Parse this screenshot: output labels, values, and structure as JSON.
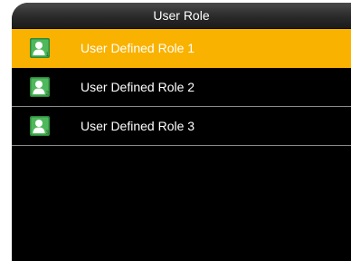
{
  "header": {
    "title": "User Role"
  },
  "roles": [
    {
      "label": "User Defined Role 1",
      "icon": "user-role-1-icon",
      "selected": true
    },
    {
      "label": "User Defined Role 2",
      "icon": "user-role-2-icon",
      "selected": false
    },
    {
      "label": "User Defined Role 3",
      "icon": "user-role-3-icon",
      "selected": false
    }
  ],
  "colors": {
    "selection": "#f9b200",
    "background": "#000000",
    "icon_green": "#3fa34d",
    "text": "#ffffff"
  }
}
